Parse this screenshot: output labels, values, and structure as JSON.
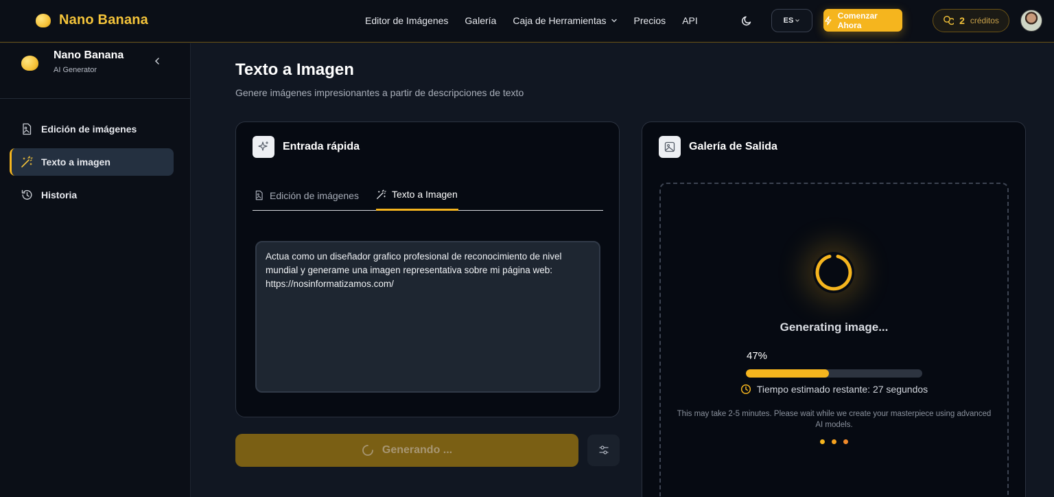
{
  "colors": {
    "accent": "#f5b51e",
    "brand": "#f5c43a",
    "background": "#111722",
    "panel": "#060a12"
  },
  "header": {
    "brand_name": "Nano Banana",
    "nav": [
      {
        "label": "Editor de Imágenes"
      },
      {
        "label": "Galería"
      },
      {
        "label": "Caja de Herramientas",
        "has_dropdown": true
      },
      {
        "label": "Precios"
      },
      {
        "label": "API"
      }
    ],
    "language": "ES",
    "start_button": "Comenzar Ahora",
    "credits_count": "2",
    "credits_label": "créditos",
    "icons": {
      "theme": "moon-icon",
      "start": "lightning-icon",
      "credits": "coins-icon"
    }
  },
  "sidebar": {
    "title": "Nano Banana",
    "subtitle": "AI Generator",
    "items": [
      {
        "label": "Edición de imágenes",
        "icon": "image-edit-icon",
        "active": false
      },
      {
        "label": "Texto a imagen",
        "icon": "magic-wand-icon",
        "active": true
      },
      {
        "label": "Historia",
        "icon": "history-icon",
        "active": false
      }
    ]
  },
  "main": {
    "title": "Texto a Imagen",
    "subtitle": "Genere imágenes impresionantes a partir de descripciones de texto",
    "input_card": {
      "title": "Entrada rápida",
      "tabs": [
        {
          "label": "Edición de imágenes",
          "active": false
        },
        {
          "label": "Texto a Imagen",
          "active": true
        }
      ],
      "prompt_value": "Actua como un diseñador grafico profesional de reconocimiento de nivel mundial y generame una imagen representativa sobre mi página web: https://nosinformatizamos.com/"
    },
    "generate_button": "Generando ...",
    "output_card": {
      "title": "Galería de Salida",
      "status_title": "Generating image...",
      "progress_percent": 47,
      "progress_label": "47%",
      "eta": "Tiempo estimado restante: 27 segundos",
      "note": "This may take 2-5 minutes. Please wait while we create your masterpiece using advanced AI models."
    }
  }
}
